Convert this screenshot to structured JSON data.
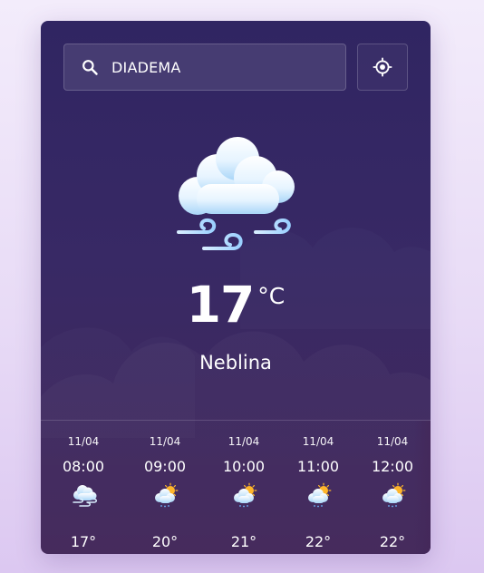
{
  "search": {
    "value": "DIADEMA",
    "icon": "search-icon"
  },
  "location": {
    "icon": "crosshair-icon"
  },
  "current": {
    "icon": "mist-cloud-icon",
    "temperature": "17",
    "unit": "°C",
    "condition": "Neblina"
  },
  "forecast": [
    {
      "date": "11/04",
      "time": "08:00",
      "icon": "mist-cloud-icon",
      "temp": "17°"
    },
    {
      "date": "11/04",
      "time": "09:00",
      "icon": "sun-rain-cloud-icon",
      "temp": "20°"
    },
    {
      "date": "11/04",
      "time": "10:00",
      "icon": "sun-rain-cloud-icon",
      "temp": "21°"
    },
    {
      "date": "11/04",
      "time": "11:00",
      "icon": "sun-rain-cloud-icon",
      "temp": "22°"
    },
    {
      "date": "11/04",
      "time": "12:00",
      "icon": "sun-rain-cloud-icon",
      "temp": "22°"
    }
  ]
}
